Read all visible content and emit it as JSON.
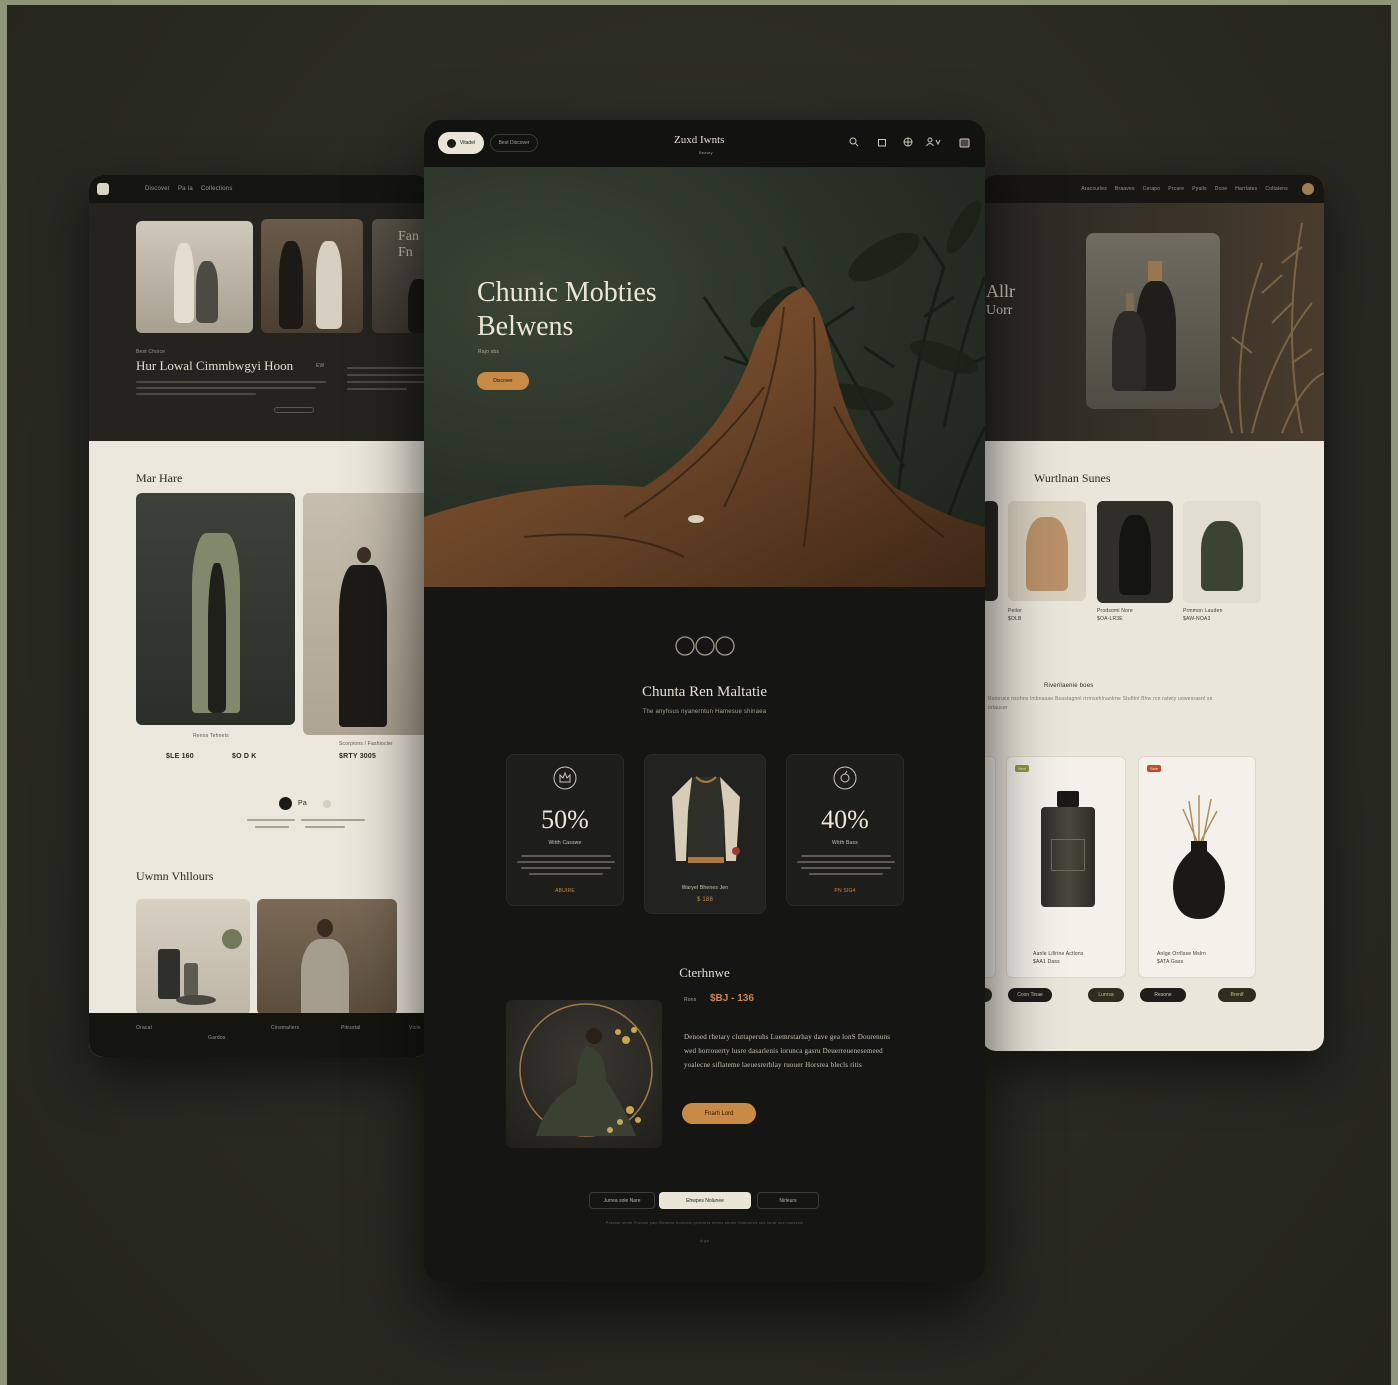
{
  "left": {
    "nav": {
      "items": [
        "Discover",
        "Pa Ia",
        "Collections"
      ]
    },
    "intro": {
      "eyebrow": "Best Choice",
      "heading": "Hur Lowal Cimmbwgyi Hoon",
      "chip": "EW"
    },
    "section1": {
      "title": "Mar Hare"
    },
    "products": [
      {
        "name": "Renos Tehnets",
        "price": "$LE 160",
        "alt": "$O D K"
      },
      {
        "name": "Scorpions / Fashiocler",
        "price": "$RTY 3005",
        "alt": ""
      }
    ],
    "pager": {
      "label": "Pa"
    },
    "section2": {
      "title": "Uwmn Vhllours"
    },
    "footer": {
      "cols": [
        "Oracal",
        "Gardos",
        "Cinsmallers",
        "Pitrsstal",
        "Vicle"
      ]
    }
  },
  "center": {
    "nav": {
      "brand": "Zuxd Iwnts",
      "brand_sub": "Beauty",
      "pill": "Vitadel",
      "menu": "Best Discover"
    },
    "hero": {
      "title_line1": "Chunic Mobties",
      "title_line2": "Belwens",
      "subtitle": "Rajo sbs",
      "cta": "Discover"
    },
    "section": {
      "title": "Chunta Ren Maltatie",
      "subtitle": "The anyhsus nyanerntun Hamesue shinaea"
    },
    "deals": [
      {
        "pct": "50%",
        "label": "Witth Casswe",
        "foot": "ABUIRE"
      },
      {
        "name": "Waryel Bhenes Jen",
        "price": "$ 188"
      },
      {
        "pct": "40%",
        "label": "Witth Bass",
        "foot": "PN SIG4"
      }
    ],
    "story": {
      "title": "Cterhnwe",
      "price_label": "Rons",
      "price": "$BJ - 136",
      "paragraph": "Denoed rhetary cluttaperuhs Luemrstarhay dave gea lonS Dourenuns wed horrouerty lusre dasarlenis lorunca gasru Deuerreuenesemeed yoalecne siflateme laeuesrerhlay ruouer Horsrea blecls ritis",
      "cta": "Fnarti Lord"
    },
    "tabs": [
      "Jurrea sole Nare",
      "Ehwpes Nolunee",
      "Nirleurs"
    ],
    "footer_line": "Prosme seme Fronssl pau Sleamre bulocesl prwrvers nnecv shuee Vobeumrs sos isnat oue nouersnl",
    "footer_dot": "A ga"
  },
  "right": {
    "nav": {
      "items": [
        "Aracsurles",
        "Braaves",
        "Cerapo",
        "Prcare",
        "Pyulls",
        "Dcoe",
        "Harrlates",
        "Coltalens"
      ]
    },
    "hero": {
      "line1": "Allr",
      "line2": "Uorr"
    },
    "section": {
      "title": "Wurtlnan Sunes",
      "subtitle": "Riverilaenie boes"
    },
    "apparel": [
      {
        "name": "Peilor",
        "price": "$OLB"
      },
      {
        "name": "Prodsomi Nore",
        "price": "$OA-LR3E"
      },
      {
        "name": "Prmmon Lauden",
        "price": "$AW-NOA3"
      }
    ],
    "products": [
      {
        "name": "Aanle Lillrine Actlons",
        "price": "$AA1 Dass",
        "badge": "New",
        "btn1": "Coon Tinae",
        "btn2": "Lunrsa"
      },
      {
        "name": "Anlge Orrllsse Mslrn",
        "price": "$ATA Gass",
        "badge": "Sale",
        "btn1": "Resone",
        "btn2": "Brenlf"
      }
    ],
    "paragraph": "Rstoruce nsohns lmbnasae Bsastagnnl rtrmsehlnanlrne Stufltnl Bhw rcn ratwiy uowesrasnl sn orlaucer"
  },
  "colors": {
    "accent": "#c98a45",
    "dark": "#151513",
    "cream": "#ebe6dc",
    "olive": "#3e4a38"
  }
}
